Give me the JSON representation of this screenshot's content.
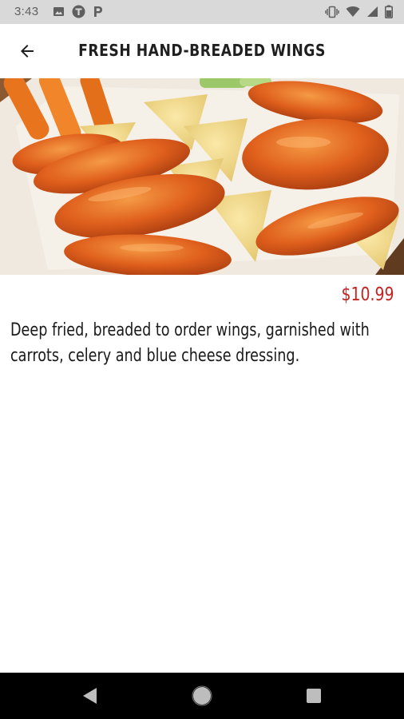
{
  "status_bar": {
    "time": "3:43",
    "left_icons": [
      "image-icon",
      "t-circle-icon",
      "p-parking-icon"
    ],
    "right_icons": [
      "vibrate-icon",
      "wifi-icon",
      "signal-icon",
      "battery-icon"
    ]
  },
  "app_bar": {
    "back_icon": "arrow-left-icon",
    "title": "FRESH HAND-BREADED WINGS"
  },
  "item": {
    "image": "buffalo-wings-photo",
    "price": "$10.99",
    "description": "Deep fried, breaded to order wings, garnished with carrots, celery and blue cheese dressing."
  },
  "nav_bar": {
    "buttons": [
      "back-triangle-icon",
      "home-circle-icon",
      "recents-square-icon"
    ]
  },
  "colors": {
    "price": "#c62222",
    "status_bar_bg": "#d9d9d9",
    "nav_bar_bg": "#000000",
    "sauce_orange": "#e0641c"
  }
}
